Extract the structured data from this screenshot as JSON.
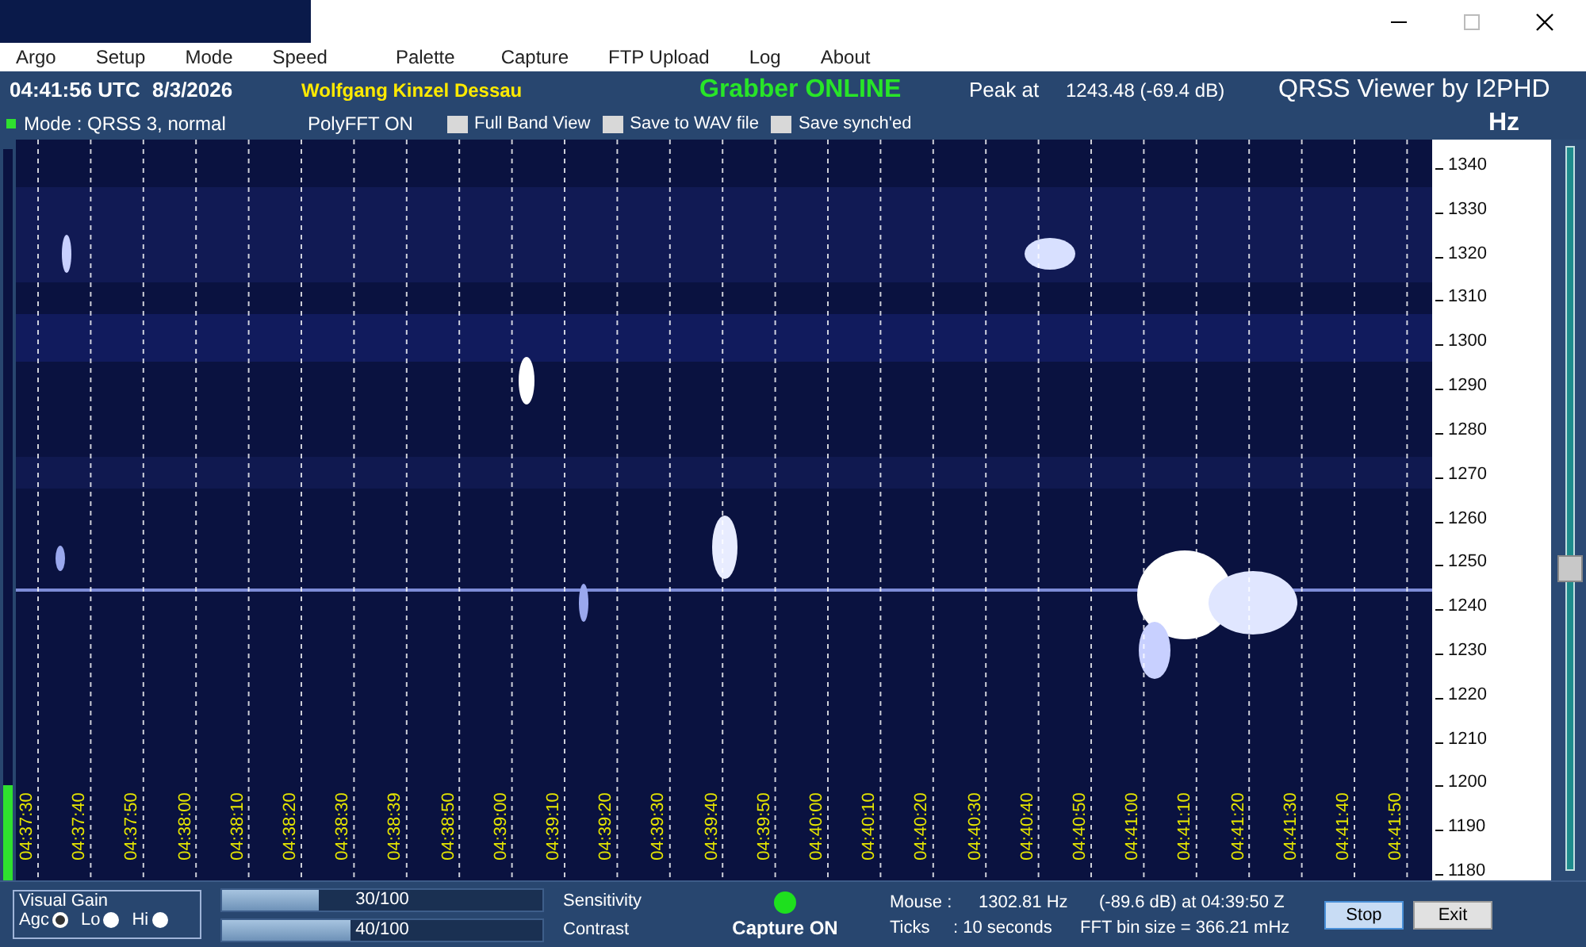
{
  "menu": [
    "Argo",
    "Setup",
    "Mode",
    "Speed",
    "Palette",
    "Capture",
    "FTP Upload",
    "Log",
    "About"
  ],
  "header": {
    "time": "04:41:56 UTC",
    "date": "8/3/2026",
    "station": "Wolfgang Kinzel Dessau",
    "grabber_status": "Grabber ONLINE",
    "peak_label": "Peak at",
    "peak_value": "1243.48 (-69.4 dB)",
    "app_title": "QRSS Viewer by I2PHD"
  },
  "toolbar": {
    "mode": "Mode : QRSS 3, normal",
    "polyfft": "PolyFFT ON",
    "checkboxes": [
      {
        "label": "Full Band View",
        "checked": false
      },
      {
        "label": "Save to WAV file",
        "checked": false
      },
      {
        "label": "Save synch'ed",
        "checked": false
      }
    ],
    "unit": "Hz"
  },
  "input_meter": {
    "level": 0.13
  },
  "time_axis": [
    "04:37:30",
    "04:37:40",
    "04:37:50",
    "04:38:00",
    "04:38:10",
    "04:38:20",
    "04:38:30",
    "04:38:39",
    "04:38:50",
    "04:39:00",
    "04:39:10",
    "04:39:20",
    "04:39:30",
    "04:39:40",
    "04:39:50",
    "04:40:00",
    "04:40:10",
    "04:40:20",
    "04:40:30",
    "04:40:40",
    "04:40:50",
    "04:41:00",
    "04:41:10",
    "04:41:20",
    "04:41:30",
    "04:41:40",
    "04:41:50"
  ],
  "freq_axis": [
    "1340",
    "1330",
    "1320",
    "1310",
    "1300",
    "1290",
    "1280",
    "1270",
    "1260",
    "1250",
    "1240",
    "1230",
    "1220",
    "1210",
    "1200",
    "1190",
    "1180"
  ],
  "freq_slider": {
    "level": 0.42
  },
  "visual_gain": {
    "title": "Visual Gain",
    "options": [
      {
        "label": "Agc",
        "selected": true
      },
      {
        "label": "Lo",
        "selected": false
      },
      {
        "label": "Hi",
        "selected": false
      }
    ]
  },
  "sliders": [
    {
      "reading": "30/100",
      "level": 0.3,
      "label": "Sensitivity"
    },
    {
      "reading": "40/100",
      "level": 0.4,
      "label": "Contrast"
    }
  ],
  "capture": {
    "on": true,
    "label": "Capture ON"
  },
  "mouse": {
    "label": "Mouse :",
    "freq": "1302.81 Hz",
    "detail": "(-89.6 dB) at 04:39:50 Z"
  },
  "ticks": {
    "label": "Ticks",
    "value": ": 10 seconds"
  },
  "fft": "FFT bin size = 366.21 mHz",
  "buttons": [
    {
      "label": "Stop",
      "focused": true
    },
    {
      "label": "Exit",
      "focused": false
    }
  ]
}
